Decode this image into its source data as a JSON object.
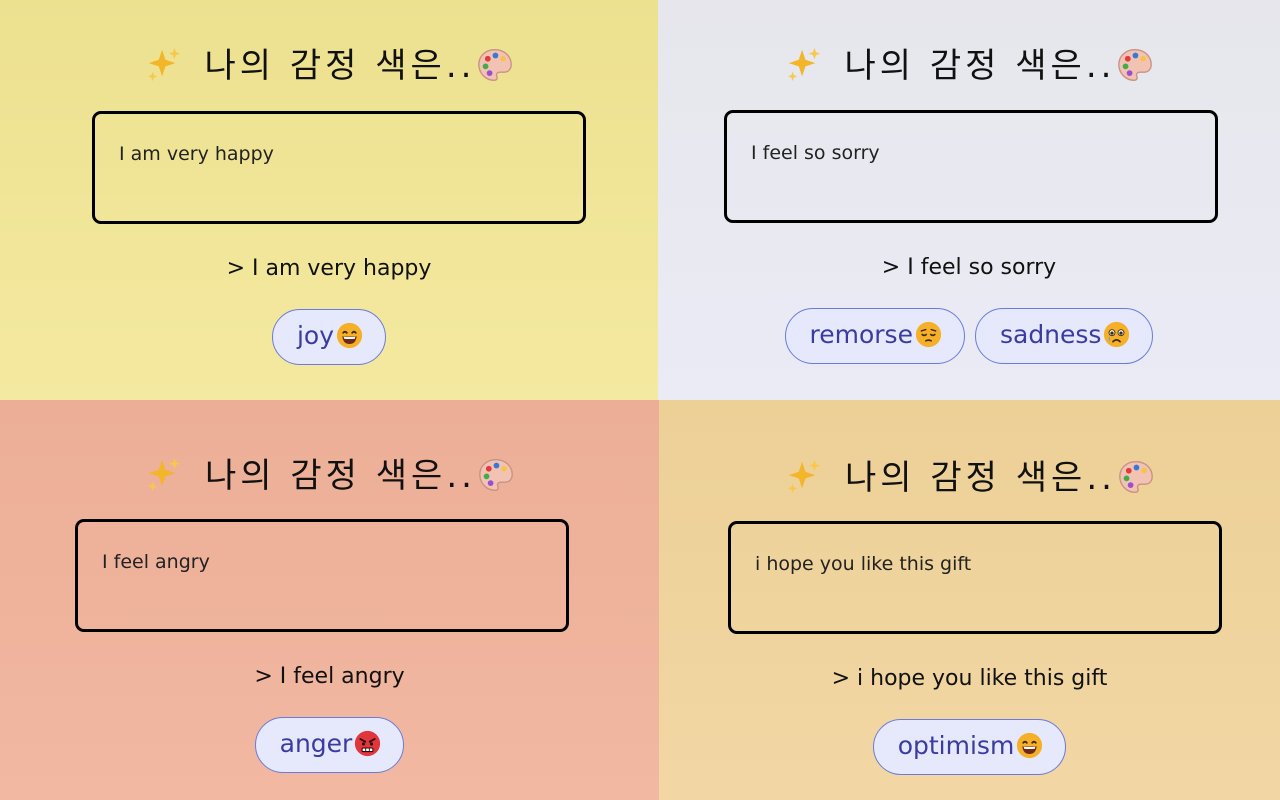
{
  "title": "나의 감정 색은..",
  "panels": [
    {
      "input_value": "I am very happy",
      "echo": "> I am very happy",
      "emotions": [
        {
          "label": "joy",
          "icon": "grinning-face-icon"
        }
      ],
      "background": "#ece18f"
    },
    {
      "input_value": "I feel so sorry",
      "echo": "> I feel so sorry",
      "emotions": [
        {
          "label": "remorse",
          "icon": "pensive-face-icon"
        },
        {
          "label": "sadness",
          "icon": "crying-face-icon"
        }
      ],
      "background": "#e6e6ec"
    },
    {
      "input_value": "I feel angry",
      "echo": "> I feel angry",
      "emotions": [
        {
          "label": "anger",
          "icon": "angry-face-icon"
        }
      ],
      "background": "#ecae96"
    },
    {
      "input_value": "i hope you like this gift",
      "echo": "> i hope you like this gift",
      "emotions": [
        {
          "label": "optimism",
          "icon": "grinning-face-icon"
        }
      ],
      "background": "#ecd096"
    }
  ],
  "icons": {
    "sparkles": "sparkles-icon",
    "palette": "artist-palette-icon"
  },
  "colors": {
    "tag_background": "#e6e8fb",
    "tag_border": "#6b7bdc",
    "tag_text": "#3a3ca0",
    "emoji_yellow": "#f5b028",
    "angry_red": "#e0363c"
  }
}
